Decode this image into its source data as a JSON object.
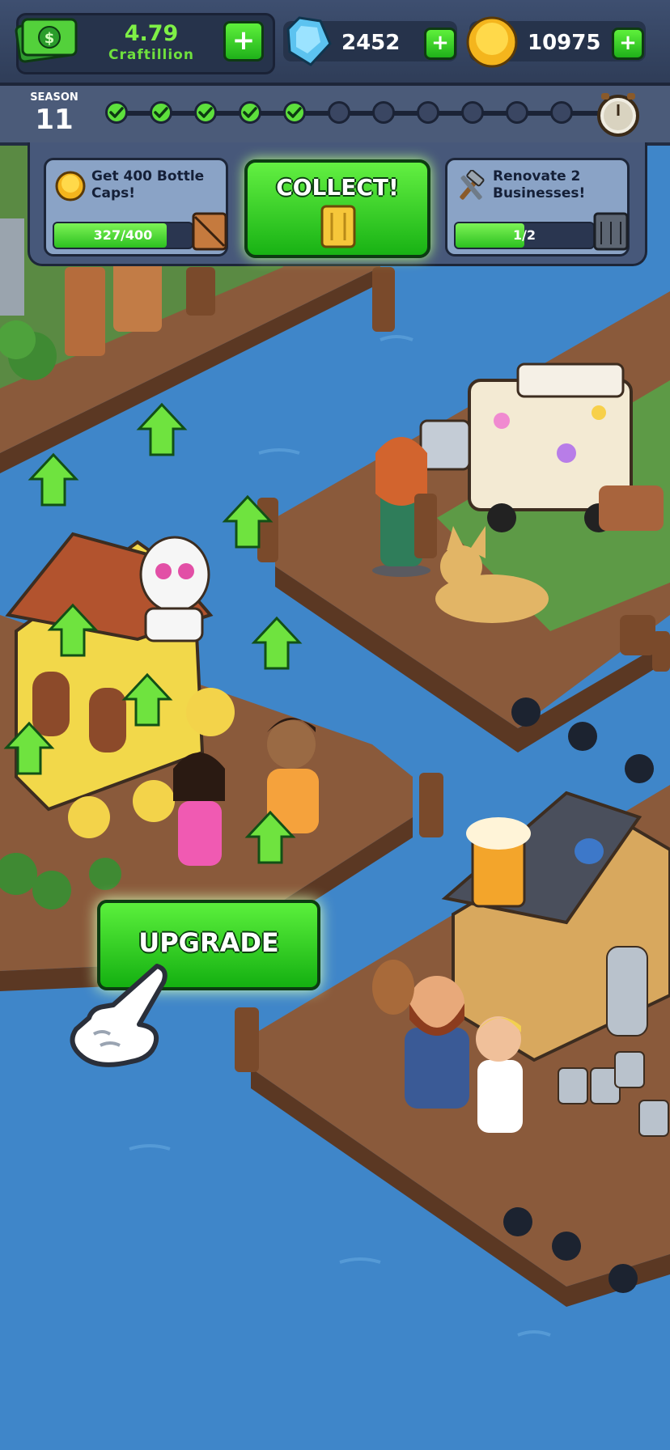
{
  "currency": {
    "cash_value": "4.79",
    "cash_unit": "Craftillion",
    "gems": "2452",
    "bottle_caps": "10975"
  },
  "season": {
    "label": "SEASON",
    "number": "11",
    "completed_steps": 5,
    "total_steps": 11
  },
  "quests": [
    {
      "title": "Get 400 Bottle Caps!",
      "progress_text": "327/400",
      "progress": 0.8175
    },
    {
      "title": "Renovate 2 Businesses!",
      "progress_text": "1/2",
      "progress": 0.5
    }
  ],
  "collect_label": "COLLECT!",
  "upgrade_label": "UPGRADE",
  "colors": {
    "water": "#3f86c9",
    "button_green": "#2cc020",
    "panel": "#47587a",
    "dock_wood": "#8a5a3b"
  },
  "icons": {
    "cash": "dollar-bill-icon",
    "gem": "diamond-gem-icon",
    "coin": "bottle-cap-icon",
    "chest": "timer-chest-icon",
    "hand": "pointing-hand-icon"
  }
}
